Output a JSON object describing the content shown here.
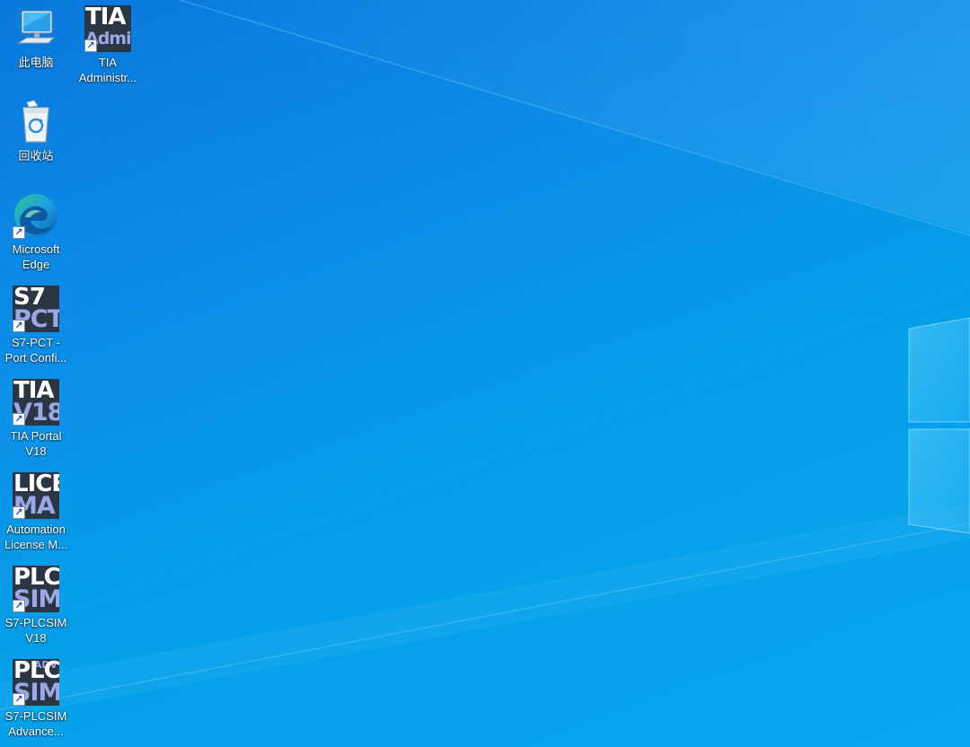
{
  "desktop": {
    "background": "#0c8fe8",
    "accent": "#ffffff",
    "icons": [
      {
        "name": "此电脑",
        "icon": "computer-icon"
      },
      {
        "name": "回收站",
        "icon": "recycle-bin-icon"
      },
      {
        "name": "Microsoft Edge",
        "icon": "edge-icon"
      },
      {
        "name": "S7-PCT - Port Confi...",
        "tile_line1": "S7",
        "tile_line2": "PCT",
        "icon": "s7-pct-icon"
      },
      {
        "name": "TIA Portal V18",
        "tile_line1": "TIA",
        "tile_line2": "V18",
        "icon": "tia-portal-icon"
      },
      {
        "name": "Automation License M...",
        "tile_line1": "LICEN",
        "tile_line2": "MA",
        "icon": "license-manager-icon"
      },
      {
        "name": "S7-PLCSIM V18",
        "tile_line1": "PLC",
        "tile_line2": "SIM",
        "icon": "plcsim-icon"
      },
      {
        "name": "S7-PLCSIM Advance...",
        "tile_line0": "ADV",
        "tile_line1": "PLC",
        "tile_line2": "SIM",
        "icon": "plcsim-advanced-icon"
      },
      {
        "name": "TIA Administr...",
        "tile_line1": "TIA",
        "tile_line2": "Admin",
        "icon": "tia-administrator-icon"
      }
    ]
  }
}
